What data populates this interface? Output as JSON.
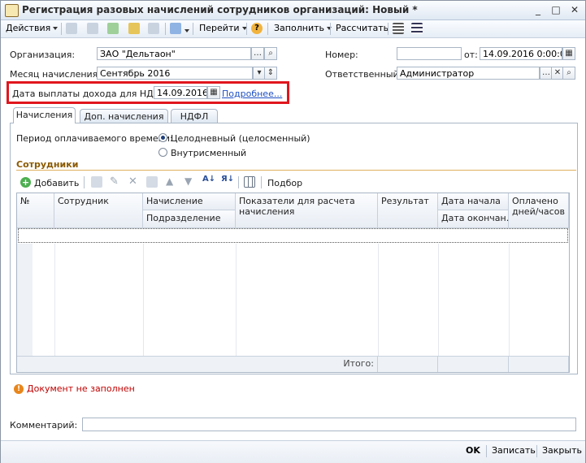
{
  "window": {
    "title": "Регистрация разовых начислений сотрудников организаций: Новый *",
    "minimize": "_",
    "maximize": "□",
    "close": "✕"
  },
  "toolbar": {
    "actions": "Действия",
    "goto": "Перейти",
    "fill": "Заполнить",
    "calculate": "Рассчитать",
    "help": "?"
  },
  "form": {
    "organization_label": "Организация:",
    "organization_value": "ЗАО \"Дельтаон\"",
    "month_label": "Месяц начисления:",
    "month_value": "Сентябрь 2016",
    "number_label": "Номер:",
    "number_value": "",
    "from_label": "от:",
    "date_value": "14.09.2016  0:00:00",
    "responsible_label": "Ответственный:",
    "responsible_value": "Администратор",
    "payout_label": "Дата выплаты дохода для НДФЛ:",
    "payout_value": "14.09.2016",
    "details_link": "Подробнее..."
  },
  "tabs": [
    {
      "label": "Начисления",
      "active": true
    },
    {
      "label": "Доп. начисления",
      "active": false
    },
    {
      "label": "НДФЛ",
      "active": false
    }
  ],
  "period": {
    "label": "Период оплачиваемого времени:",
    "options": [
      {
        "label": "Целодневный (целосменный)",
        "selected": true
      },
      {
        "label": "Внутрисменный",
        "selected": false
      }
    ]
  },
  "employees": {
    "section_title": "Сотрудники",
    "add_label": "Добавить",
    "pick_label": "Подбор",
    "columns": {
      "num": "№",
      "employee": "Сотрудник",
      "accrual": "Начисление",
      "department": "Подразделение",
      "indicators": "Показатели для расчета начисления",
      "result": "Результат",
      "start_date": "Дата начала",
      "end_date": "Дата окончан...",
      "paid": "Оплачено дней/часов"
    },
    "total_label": "Итого:"
  },
  "status": {
    "error": "Документ не заполнен"
  },
  "comment": {
    "label": "Комментарий:",
    "value": ""
  },
  "buttons": {
    "ok": "OK",
    "save": "Записать",
    "close": "Закрыть"
  },
  "colors": {
    "highlight": "#e0161d",
    "link": "#1f4fc3",
    "error": "#c00000",
    "section": "#8b5a00"
  }
}
